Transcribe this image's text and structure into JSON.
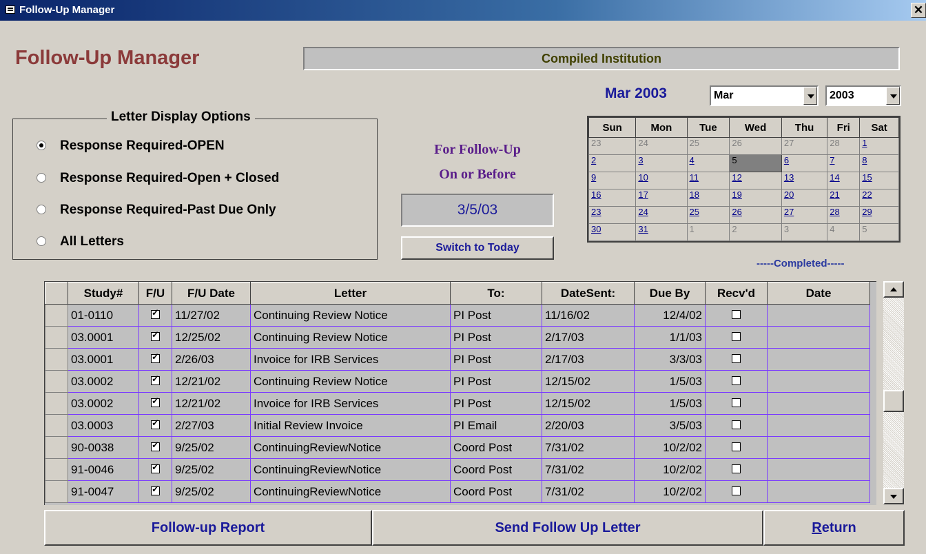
{
  "window": {
    "title": "Follow-Up Manager",
    "close_glyph": "✕",
    "icon": "form-icon"
  },
  "header": {
    "title": "Follow-Up Manager",
    "institution": "Compiled Institution"
  },
  "calendar": {
    "month_label": "Mar 2003",
    "month_select": "Mar",
    "year_select": "2003",
    "weekdays": [
      "Sun",
      "Mon",
      "Tue",
      "Wed",
      "Thu",
      "Fri",
      "Sat"
    ],
    "weeks": [
      [
        {
          "d": "23",
          "m": "other"
        },
        {
          "d": "24",
          "m": "other"
        },
        {
          "d": "25",
          "m": "other"
        },
        {
          "d": "26",
          "m": "other"
        },
        {
          "d": "27",
          "m": "other"
        },
        {
          "d": "28",
          "m": "other"
        },
        {
          "d": "1",
          "m": "cur"
        }
      ],
      [
        {
          "d": "2",
          "m": "cur"
        },
        {
          "d": "3",
          "m": "cur"
        },
        {
          "d": "4",
          "m": "cur"
        },
        {
          "d": "5",
          "m": "sel"
        },
        {
          "d": "6",
          "m": "cur"
        },
        {
          "d": "7",
          "m": "cur"
        },
        {
          "d": "8",
          "m": "cur"
        }
      ],
      [
        {
          "d": "9",
          "m": "cur"
        },
        {
          "d": "10",
          "m": "cur"
        },
        {
          "d": "11",
          "m": "cur"
        },
        {
          "d": "12",
          "m": "cur"
        },
        {
          "d": "13",
          "m": "cur"
        },
        {
          "d": "14",
          "m": "cur"
        },
        {
          "d": "15",
          "m": "cur"
        }
      ],
      [
        {
          "d": "16",
          "m": "cur"
        },
        {
          "d": "17",
          "m": "cur"
        },
        {
          "d": "18",
          "m": "cur"
        },
        {
          "d": "19",
          "m": "cur"
        },
        {
          "d": "20",
          "m": "cur"
        },
        {
          "d": "21",
          "m": "cur"
        },
        {
          "d": "22",
          "m": "cur"
        }
      ],
      [
        {
          "d": "23",
          "m": "cur"
        },
        {
          "d": "24",
          "m": "cur"
        },
        {
          "d": "25",
          "m": "cur"
        },
        {
          "d": "26",
          "m": "cur"
        },
        {
          "d": "27",
          "m": "cur"
        },
        {
          "d": "28",
          "m": "cur"
        },
        {
          "d": "29",
          "m": "cur"
        }
      ],
      [
        {
          "d": "30",
          "m": "cur"
        },
        {
          "d": "31",
          "m": "cur"
        },
        {
          "d": "1",
          "m": "other"
        },
        {
          "d": "2",
          "m": "other"
        },
        {
          "d": "3",
          "m": "other"
        },
        {
          "d": "4",
          "m": "other"
        },
        {
          "d": "5",
          "m": "other"
        }
      ]
    ]
  },
  "options": {
    "legend": "Letter Display Options",
    "items": [
      {
        "label": "Response Required-OPEN",
        "selected": true
      },
      {
        "label": "Response Required-Open + Closed",
        "selected": false
      },
      {
        "label": "Response Required-Past Due Only",
        "selected": false
      },
      {
        "label": "All Letters",
        "selected": false
      }
    ]
  },
  "followup": {
    "label_line1": "For Follow-Up",
    "label_line2": "On or Before",
    "date": "3/5/03",
    "switch_label": "Switch to Today"
  },
  "completed_label": "-----Completed-----",
  "grid": {
    "columns": [
      "",
      "Study#",
      "F/U",
      "F/U Date",
      "Letter",
      "To:",
      "DateSent:",
      "Due By",
      "Recv'd",
      "Date"
    ],
    "rows": [
      {
        "study": "01-0110",
        "fu": true,
        "fu_date": "11/27/02",
        "letter": "Continuing Review Notice",
        "to": "PI Post",
        "sent": "11/16/02",
        "due": "12/4/02",
        "recvd": false,
        "date": ""
      },
      {
        "study": "03.0001",
        "fu": true,
        "fu_date": "12/25/02",
        "letter": "Continuing Review Notice",
        "to": "PI Post",
        "sent": "2/17/03",
        "due": "1/1/03",
        "recvd": false,
        "date": ""
      },
      {
        "study": "03.0001",
        "fu": true,
        "fu_date": "2/26/03",
        "letter": "Invoice for IRB Services",
        "to": "PI Post",
        "sent": "2/17/03",
        "due": "3/3/03",
        "recvd": false,
        "date": ""
      },
      {
        "study": "03.0002",
        "fu": true,
        "fu_date": "12/21/02",
        "letter": "Continuing Review Notice",
        "to": "PI Post",
        "sent": "12/15/02",
        "due": "1/5/03",
        "recvd": false,
        "date": ""
      },
      {
        "study": "03.0002",
        "fu": true,
        "fu_date": "12/21/02",
        "letter": "Invoice for IRB Services",
        "to": "PI Post",
        "sent": "12/15/02",
        "due": "1/5/03",
        "recvd": false,
        "date": ""
      },
      {
        "study": "03.0003",
        "fu": true,
        "fu_date": "2/27/03",
        "letter": "Initial Review Invoice",
        "to": "PI Email",
        "sent": "2/20/03",
        "due": "3/5/03",
        "recvd": false,
        "date": ""
      },
      {
        "study": "90-0038",
        "fu": true,
        "fu_date": "9/25/02",
        "letter": "ContinuingReviewNotice",
        "to": "Coord Post",
        "sent": "7/31/02",
        "due": "10/2/02",
        "recvd": false,
        "date": ""
      },
      {
        "study": "91-0046",
        "fu": true,
        "fu_date": "9/25/02",
        "letter": "ContinuingReviewNotice",
        "to": "Coord Post",
        "sent": "7/31/02",
        "due": "10/2/02",
        "recvd": false,
        "date": ""
      },
      {
        "study": "91-0047",
        "fu": true,
        "fu_date": "9/25/02",
        "letter": "ContinuingReviewNotice",
        "to": "Coord Post",
        "sent": "7/31/02",
        "due": "10/2/02",
        "recvd": false,
        "date": ""
      }
    ]
  },
  "footer": {
    "report_label": "Follow-up Report",
    "send_label": "Send Follow Up Letter",
    "return_label": "Return"
  }
}
